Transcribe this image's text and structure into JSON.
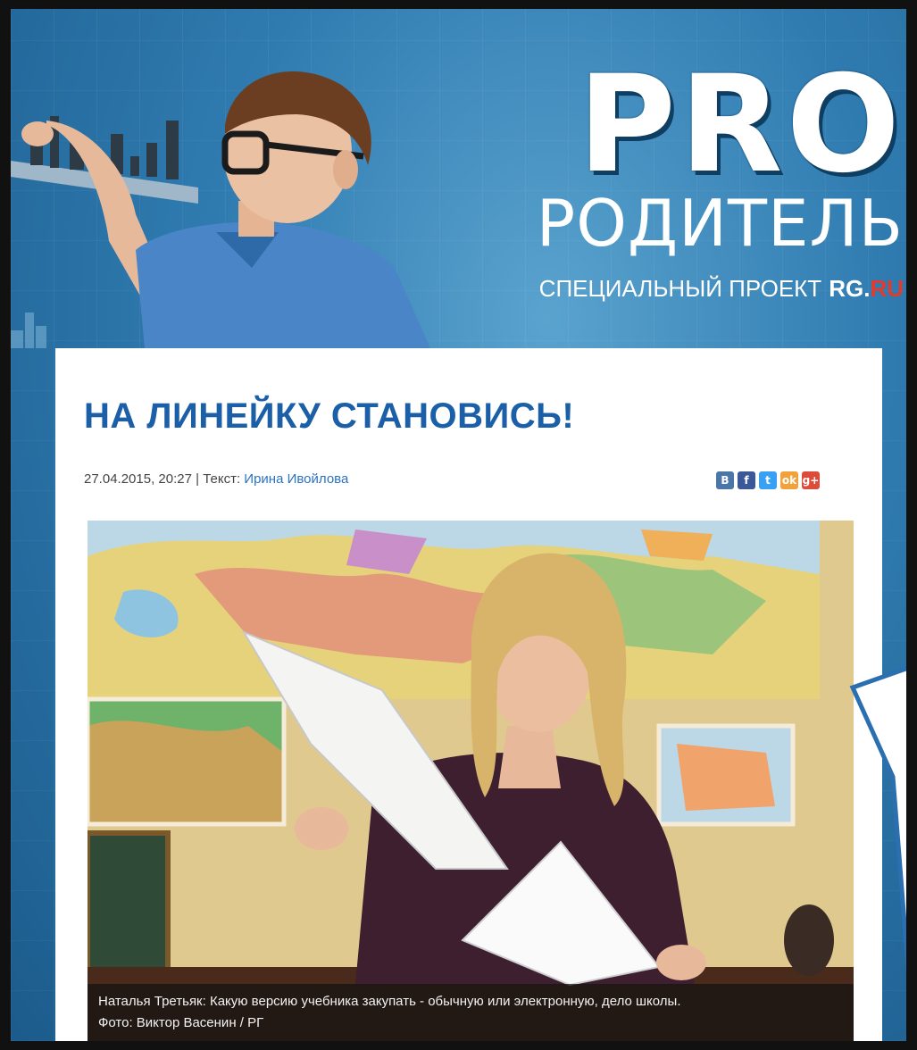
{
  "header": {
    "logo_pro": "PRO",
    "logo_roditel": "РОДИТЕЛЬ",
    "special_project": "СПЕЦИАЛЬНЫЙ ПРОЕКТ",
    "brand_rg": "RG.",
    "brand_ru": "RU"
  },
  "article": {
    "title": "НА ЛИНЕЙКУ СТАНОВИСЬ!",
    "datetime": "27.04.2015, 20:27",
    "separator": " | ",
    "author_label": "Текст: ",
    "author": "Ирина Ивойлова",
    "caption": "Наталья Третьяк: Какую версию учебника закупать - обычную или электронную, дело школы.",
    "credit": "Фото: Виктор Васенин / РГ"
  },
  "share": {
    "vk": "B",
    "facebook": "f",
    "twitter": "t",
    "odnoklassniki": "ok",
    "googleplus": "g+"
  },
  "colors": {
    "title": "#1a5fa8",
    "author_link": "#2a73c2",
    "background": "#2f7bb0",
    "brand_ru": "#e13b2d"
  }
}
